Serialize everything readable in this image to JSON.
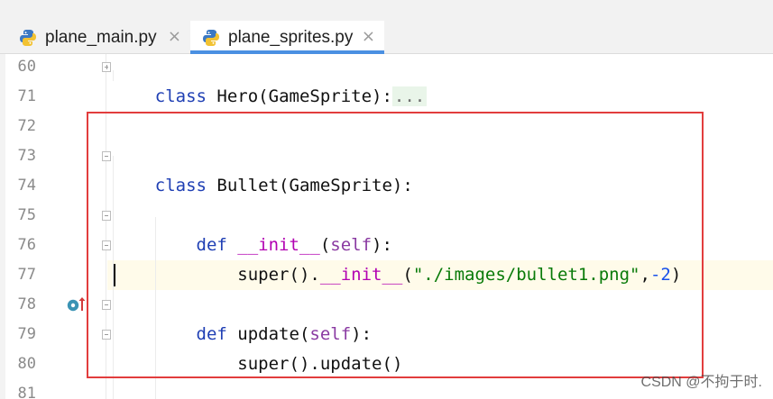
{
  "tabs": [
    {
      "label": "plane_main.py",
      "close_icon": "×",
      "icon": "python-file-icon"
    },
    {
      "label": "plane_sprites.py",
      "close_icon": "×",
      "icon": "python-file-icon",
      "active": true
    }
  ],
  "editor": {
    "line_numbers": [
      "60",
      "71",
      "72",
      "73",
      "74",
      "75",
      "76",
      "77",
      "78",
      "79",
      "80",
      "81"
    ],
    "lines": [
      {
        "class_kw": "class ",
        "class_name": "Hero",
        "open_paren": "(",
        "base_name": "GameSprite",
        "close_paren": ")",
        "colon": ":",
        "folded": "..."
      },
      {},
      {},
      {
        "class_kw": "class ",
        "class_name": "Bullet",
        "open_paren": "(",
        "base_name": "GameSprite",
        "close_paren": ")",
        "colon": ":"
      },
      {},
      {
        "indent": "    ",
        "def_kw": "def ",
        "func": "__init__",
        "open_paren": "(",
        "self": "self",
        "close_paren": ")",
        "colon": ":"
      },
      {
        "indent": "        ",
        "super": "super",
        "open_call": "(",
        "close_call": ")",
        "dot": ".",
        "method": "__init__",
        "open_paren": "(",
        "string": "\"./images/bullet1.png\"",
        "comma": ",",
        "number": "-2",
        "close_paren": ")"
      },
      {},
      {
        "indent": "    ",
        "def_kw": "def ",
        "func": "update",
        "open_paren": "(",
        "self": "self",
        "close_paren": ")",
        "colon": ":"
      },
      {
        "indent": "        ",
        "super": "super",
        "open_call": "(",
        "close_call": ")",
        "dot": ".",
        "method": "update",
        "open_paren": "(",
        "close_paren": ")"
      },
      {},
      {}
    ]
  },
  "watermark": "CSDN @不拘于时.",
  "colors": {
    "keyword": "#1f3fb4",
    "self": "#8a3aa2",
    "dunder": "#b200b2",
    "string": "#087a08",
    "number": "#1750eb",
    "tab_underline": "#4a90e2",
    "highlight_box": "#e23d3d",
    "current_line": "#fffbea"
  },
  "icons": {
    "tab_file": "python-file-icon",
    "close": "close-icon",
    "fold_expand": "fold-expand-icon",
    "fold_collapse": "fold-collapse-icon",
    "breakpoint": "breakpoint-icon",
    "override": "up-arrow-icon"
  }
}
